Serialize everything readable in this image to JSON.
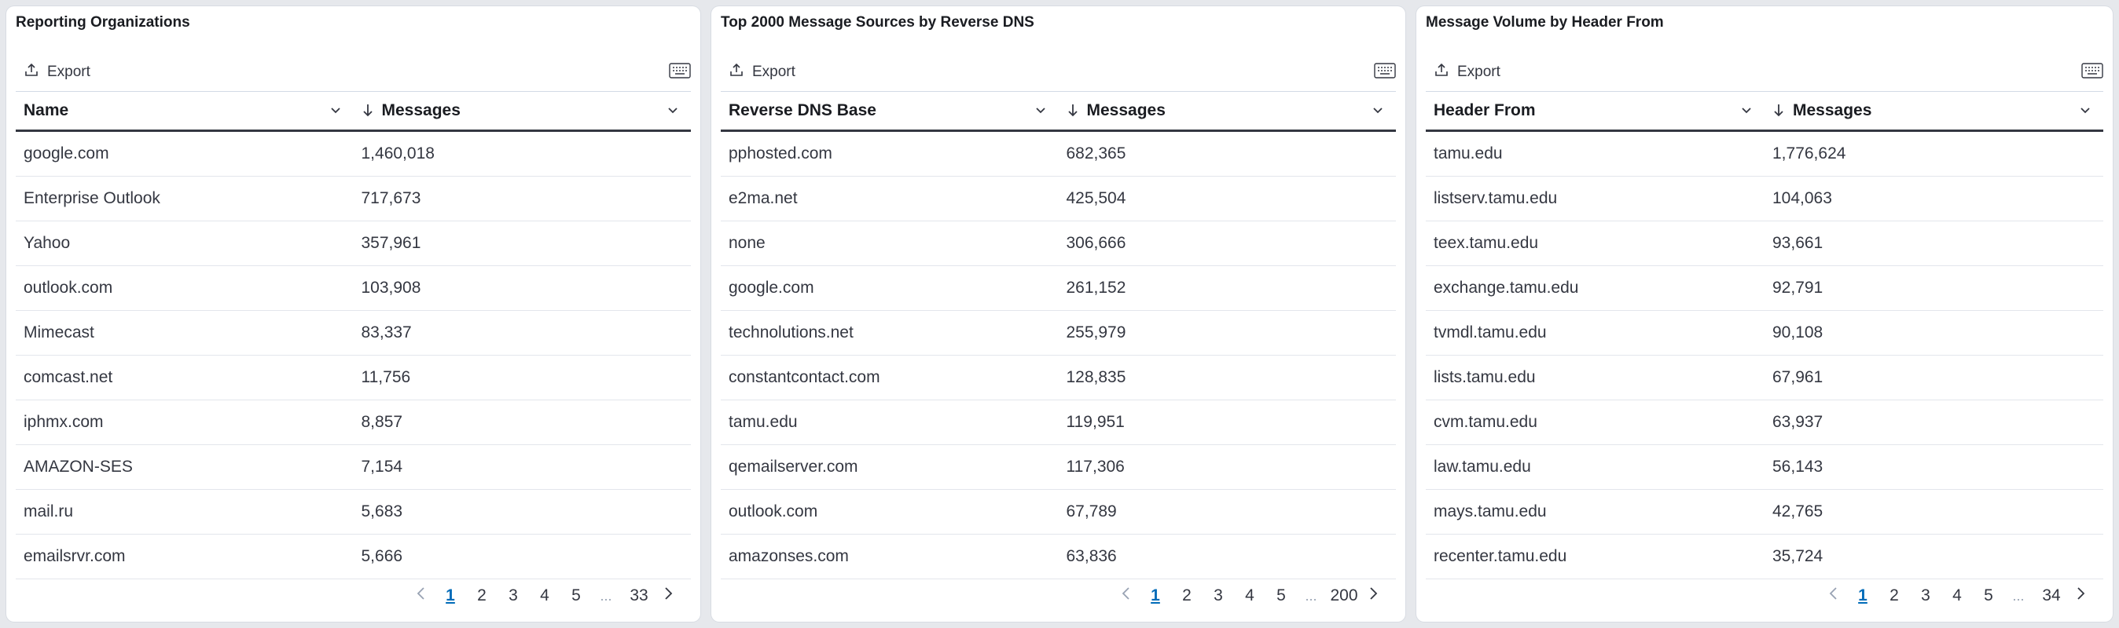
{
  "panels": [
    {
      "title": "Reporting Organizations",
      "export_label": "Export",
      "columns": [
        "Name",
        "Messages"
      ],
      "rows": [
        [
          "google.com",
          "1,460,018"
        ],
        [
          "Enterprise Outlook",
          "717,673"
        ],
        [
          "Yahoo",
          "357,961"
        ],
        [
          "outlook.com",
          "103,908"
        ],
        [
          "Mimecast",
          "83,337"
        ],
        [
          "comcast.net",
          "11,756"
        ],
        [
          "iphmx.com",
          "8,857"
        ],
        [
          "AMAZON-SES",
          "7,154"
        ],
        [
          "mail.ru",
          "5,683"
        ],
        [
          "emailsrvr.com",
          "5,666"
        ]
      ],
      "pages": [
        "1",
        "2",
        "3",
        "4",
        "5"
      ],
      "ellipsis": "...",
      "last_page": "33"
    },
    {
      "title": "Top 2000 Message Sources by Reverse DNS",
      "export_label": "Export",
      "columns": [
        "Reverse DNS Base",
        "Messages"
      ],
      "rows": [
        [
          "pphosted.com",
          "682,365"
        ],
        [
          "e2ma.net",
          "425,504"
        ],
        [
          "none",
          "306,666"
        ],
        [
          "google.com",
          "261,152"
        ],
        [
          "technolutions.net",
          "255,979"
        ],
        [
          "constantcontact.com",
          "128,835"
        ],
        [
          "tamu.edu",
          "119,951"
        ],
        [
          "qemailserver.com",
          "117,306"
        ],
        [
          "outlook.com",
          "67,789"
        ],
        [
          "amazonses.com",
          "63,836"
        ]
      ],
      "pages": [
        "1",
        "2",
        "3",
        "4",
        "5"
      ],
      "ellipsis": "...",
      "last_page": "200"
    },
    {
      "title": "Message Volume by Header From",
      "export_label": "Export",
      "columns": [
        "Header From",
        "Messages"
      ],
      "rows": [
        [
          "tamu.edu",
          "1,776,624"
        ],
        [
          "listserv.tamu.edu",
          "104,063"
        ],
        [
          "teex.tamu.edu",
          "93,661"
        ],
        [
          "exchange.tamu.edu",
          "92,791"
        ],
        [
          "tvmdl.tamu.edu",
          "90,108"
        ],
        [
          "lists.tamu.edu",
          "67,961"
        ],
        [
          "cvm.tamu.edu",
          "63,937"
        ],
        [
          "law.tamu.edu",
          "56,143"
        ],
        [
          "mays.tamu.edu",
          "42,765"
        ],
        [
          "recenter.tamu.edu",
          "35,724"
        ]
      ],
      "pages": [
        "1",
        "2",
        "3",
        "4",
        "5"
      ],
      "ellipsis": "...",
      "last_page": "34"
    }
  ],
  "icons": {
    "export": "export-icon",
    "keyboard": "keyboard-icon",
    "sort": "sort-down-arrow-icon",
    "column_menu": "chevron-down-icon",
    "prev": "chevron-left-icon",
    "next": "chevron-right-icon"
  },
  "colors": {
    "active_page": "#006bb8",
    "header_rule": "#343741",
    "panel_bg": "#ffffff",
    "page_bg": "#e6e8ec"
  }
}
